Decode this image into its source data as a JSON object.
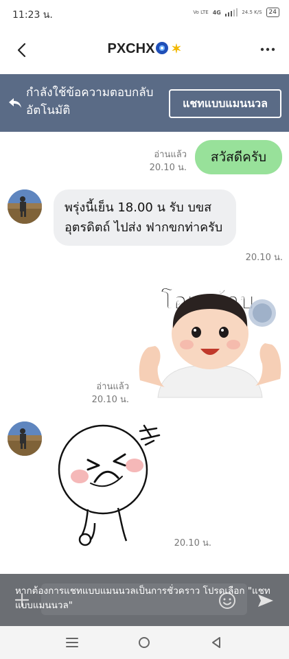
{
  "status": {
    "time": "11:23 น.",
    "volte": "Vo LTE",
    "network": "4G",
    "speed": "24.5 K/S",
    "battery": "24"
  },
  "header": {
    "title": "PXCHX",
    "back_icon": "chevron-left-icon",
    "more_icon": "more-dots-icon"
  },
  "banner": {
    "text": "กำลังใช้ข้อความตอบกลับอัตโนมัติ",
    "button_label": "แชทแบบแมนนวล",
    "icon": "reply-icon"
  },
  "messages": {
    "m1": {
      "text": "สวัสดีครับ",
      "read": "อ่านแล้ว",
      "time": "20.10 น."
    },
    "m2": {
      "text": "พรุ่งนี้เย็น 18.00 น รับ บขส อุตรดิตถ์ ไปส่ง ฟากขกท่าครับ",
      "time": "20.10 น."
    },
    "m3": {
      "sticker_text": "โอเคค้าบ",
      "read": "อ่านแล้ว",
      "time": "20.10 น."
    },
    "m4": {
      "time": "20.10 น."
    }
  },
  "input": {
    "notice": "หากต้องการแชทแบบแมนนวลเป็นการชั่วคราว โปรดเลือก \"แชทแบบแมนนวล\""
  },
  "colors": {
    "banner": "#5a6b86",
    "outgoing_bubble": "#98e19a",
    "incoming_bubble": "#eeeff1",
    "notice_overlay": "#6b6e73"
  }
}
